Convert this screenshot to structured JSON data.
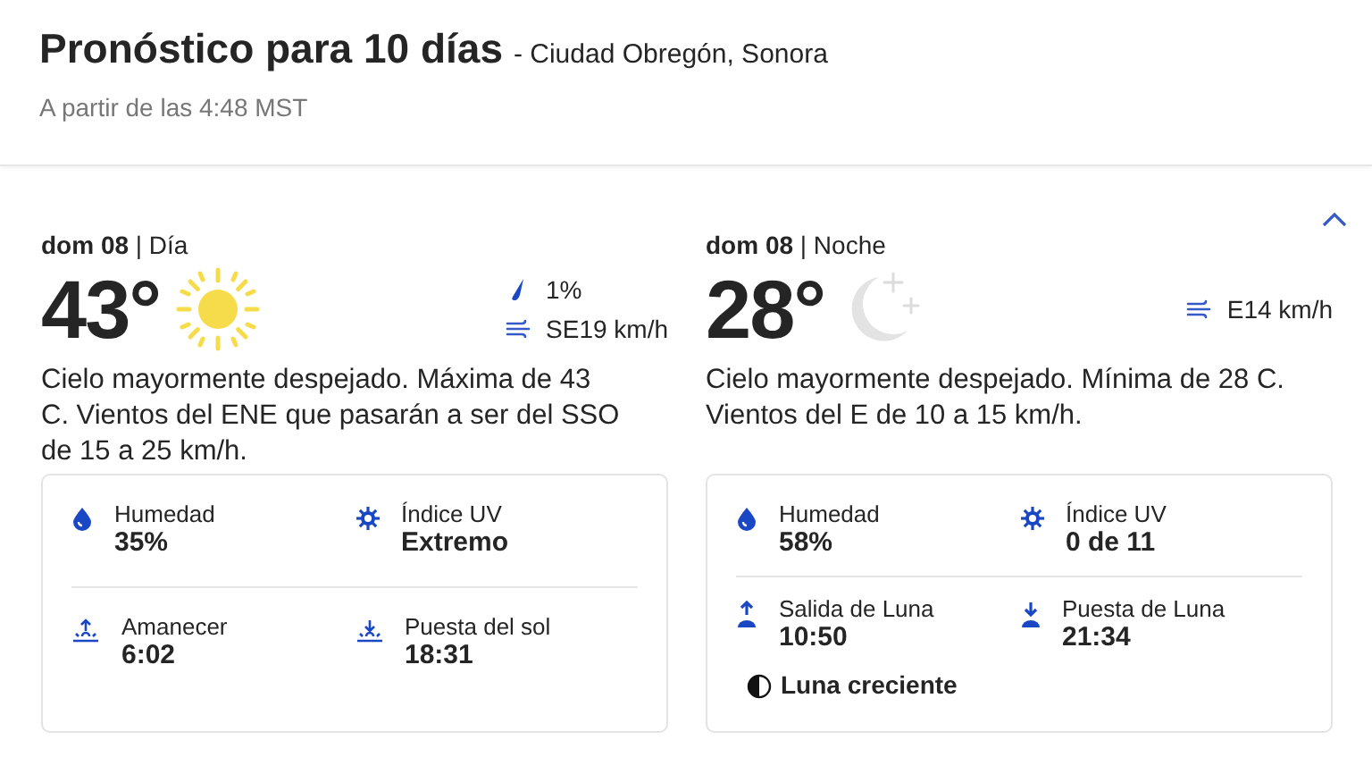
{
  "header": {
    "title": "Pronóstico para 10 días",
    "location": "- Ciudad Obregón, Sonora",
    "updated": "A partir de las 4:48 MST"
  },
  "section": {
    "expanded": true
  },
  "periods": [
    {
      "day": "dom 08",
      "part": "| Día",
      "temp": "43°",
      "kind": "sun",
      "stats": [
        {
          "kind": "precip",
          "text": "1%"
        },
        {
          "kind": "wind",
          "text": "SE19 km/h"
        }
      ],
      "narrative": "Cielo mayormente despejado. Máxima de 43 C. Vientos del ENE que pasarán a ser del SSO de 15 a 25 km/h.",
      "details": [
        [
          {
            "kind": "humidity",
            "label": "Humedad",
            "value": "35%"
          },
          {
            "kind": "uv",
            "label": "Índice UV",
            "value": "Extremo"
          }
        ],
        [
          {
            "kind": "sunrise",
            "label": "Amanecer",
            "value": "6:02"
          },
          {
            "kind": "sunset",
            "label": "Puesta del sol",
            "value": "18:31"
          }
        ]
      ]
    },
    {
      "day": "dom 08",
      "part": "| Noche",
      "temp": "28°",
      "kind": "moon",
      "stats": [
        {
          "kind": "wind",
          "text": "E14 km/h"
        }
      ],
      "narrative": "Cielo mayormente despejado. Mínima de 28 C. Vientos del E de 10 a 15 km/h.",
      "details": [
        [
          {
            "kind": "humidity",
            "label": "Humedad",
            "value": "58%"
          },
          {
            "kind": "uv",
            "label": "Índice UV",
            "value": "0 de 11"
          }
        ],
        [
          {
            "kind": "moonrise",
            "label": "Salida de Luna",
            "value": "10:50"
          },
          {
            "kind": "moonset",
            "label": "Puesta de Luna",
            "value": "21:34"
          }
        ]
      ],
      "moon_phase": "Luna creciente"
    }
  ]
}
